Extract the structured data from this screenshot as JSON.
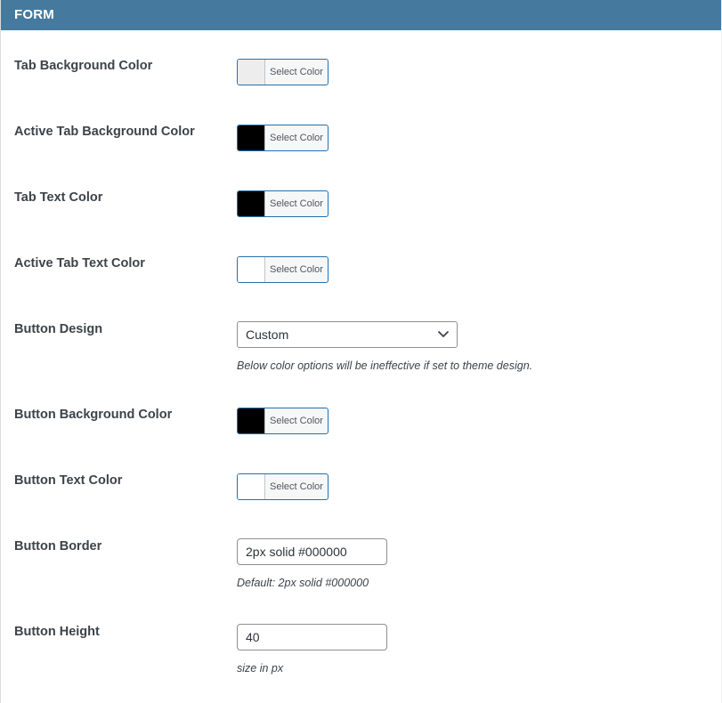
{
  "header": {
    "title": "FORM"
  },
  "fields": {
    "tab_bg": {
      "label": "Tab Background Color",
      "button": "Select Color",
      "swatch": "#ededed"
    },
    "active_tab_bg": {
      "label": "Active Tab Background Color",
      "button": "Select Color",
      "swatch": "#000000"
    },
    "tab_text": {
      "label": "Tab Text Color",
      "button": "Select Color",
      "swatch": "#000000"
    },
    "active_tab_text": {
      "label": "Active Tab Text Color",
      "button": "Select Color",
      "swatch": "#ffffff"
    },
    "button_design": {
      "label": "Button Design",
      "selected": "Custom",
      "description": "Below color options will be ineffective if set to theme design."
    },
    "button_bg": {
      "label": "Button Background Color",
      "button": "Select Color",
      "swatch": "#000000"
    },
    "button_text": {
      "label": "Button Text Color",
      "button": "Select Color",
      "swatch": "#ffffff"
    },
    "button_border": {
      "label": "Button Border",
      "value": "2px solid #000000",
      "description": "Default: 2px solid #000000"
    },
    "button_height": {
      "label": "Button Height",
      "value": "40",
      "description": "size in px"
    }
  }
}
